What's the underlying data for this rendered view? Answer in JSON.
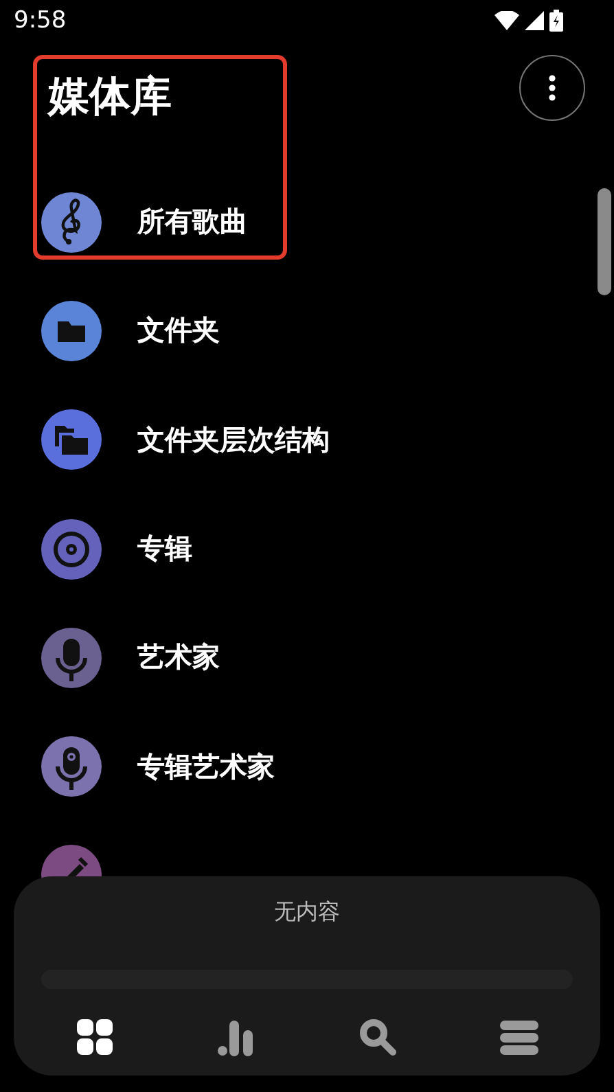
{
  "status_bar": {
    "time": "9:58"
  },
  "header": {
    "title": "媒体库"
  },
  "library_items": [
    {
      "label": "所有歌曲",
      "kind": "songs",
      "color": "#6e86d4"
    },
    {
      "label": "文件夹",
      "kind": "folder",
      "color": "#5a84d8"
    },
    {
      "label": "文件夹层次结构",
      "kind": "hierarchy",
      "color": "#5b6fdc"
    },
    {
      "label": "专辑",
      "kind": "album",
      "color": "#6562bc"
    },
    {
      "label": "艺术家",
      "kind": "artist",
      "color": "#6b6190"
    },
    {
      "label": "专辑艺术家",
      "kind": "album_artist",
      "color": "#7b72ae"
    },
    {
      "kind": "genre",
      "color": "#7b4b82"
    }
  ],
  "player": {
    "status": "无内容",
    "level": 0
  },
  "bottom_nav": [
    {
      "kind": "library",
      "selected": true
    },
    {
      "kind": "stats",
      "selected": false
    },
    {
      "kind": "search",
      "selected": false
    },
    {
      "kind": "queue",
      "selected": false
    }
  ]
}
